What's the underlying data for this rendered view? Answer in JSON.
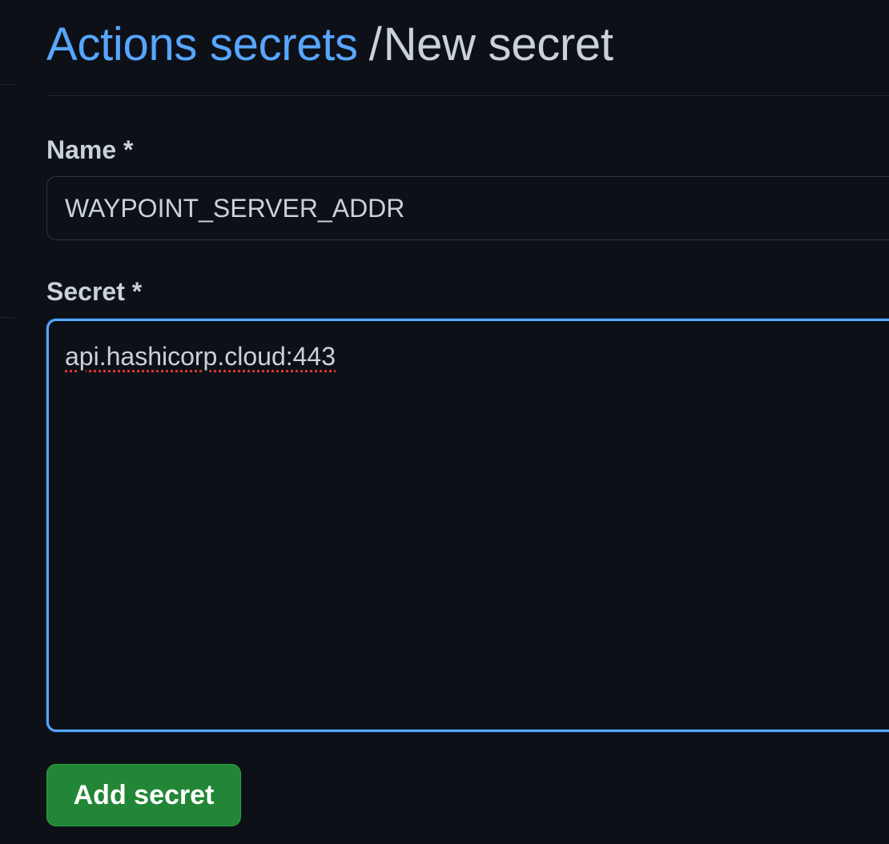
{
  "header": {
    "breadcrumb_link": "Actions secrets",
    "separator": "/",
    "current_page": "New secret"
  },
  "form": {
    "name_label": "Name *",
    "name_value": "WAYPOINT_SERVER_ADDR",
    "secret_label": "Secret *",
    "secret_value": "api.hashicorp.cloud:443",
    "submit_label": "Add secret"
  },
  "colors": {
    "background": "#0d1117",
    "link": "#58a6ff",
    "text": "#c9d1d9",
    "focus_border": "#58a6ff",
    "button_green": "#238636",
    "spellcheck_underline": "#da3633"
  }
}
